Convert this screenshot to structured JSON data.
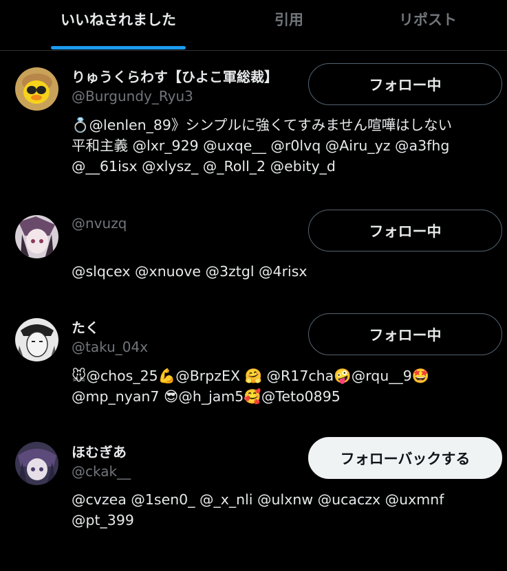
{
  "tabs": [
    {
      "label": "いいねされました",
      "active": true
    },
    {
      "label": "引用",
      "active": false
    },
    {
      "label": "リポスト",
      "active": false
    }
  ],
  "users": [
    {
      "name": "りゅうくらわす【ひよこ軍総裁】",
      "handle": "@Burgundy_Ryu3",
      "button": "フォロー中",
      "bio_lines": [
        "💍@lenlen_89》シンプルに強くてすみません喧嘩はしない",
        "平和主義 @lxr_929 @uxqe__ @r0lvq @Airu_yz @a3fhg",
        "@__61isx @xlysz_ @_Roll_2 @ebity_d"
      ]
    },
    {
      "name": "",
      "handle": "@nvuzq",
      "button": "フォロー中",
      "bio_lines": [
        "@slqcex @xnuove @3ztgl @4risx"
      ]
    },
    {
      "name": "たく",
      "handle": "@taku_04x",
      "button": "フォロー中",
      "bio_lines": [
        "🐭@chos_25💪@BrpzEX 🤗 @R17cha🤪@rqu__9🤩",
        "@mp_nyan7 😎@h_jam5🥰@Teto0895"
      ]
    },
    {
      "name": "ほむぎあ",
      "handle": "@ckak__",
      "button": "フォローバックする",
      "bio_lines": [
        "@cvzea @1sen0_ @_x_nli @ulxnw @ucaczx @uxmnf",
        "@pt_399"
      ]
    }
  ],
  "colors": {
    "accent": "#1d9bf0",
    "background": "#000000",
    "secondary_text": "#71767b"
  }
}
